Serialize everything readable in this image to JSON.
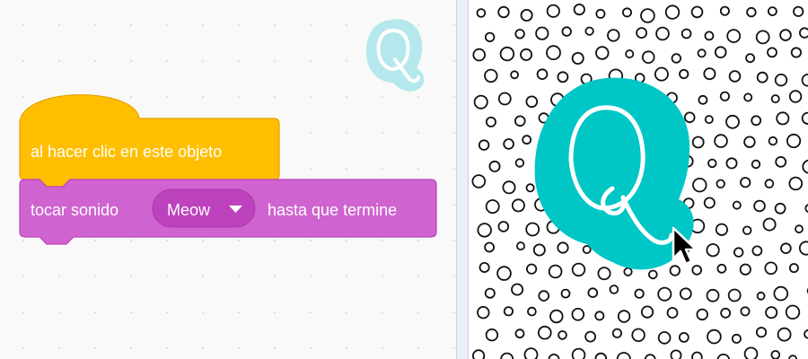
{
  "code_area": {
    "hat_block": {
      "label": "al hacer clic en este objeto",
      "color": "#FFBF00"
    },
    "sound_block": {
      "prefix": "tocar sonido",
      "sound_dropdown": {
        "selected": "Meow",
        "icon": "caret-down-icon"
      },
      "suffix": "hasta que termine",
      "color": "#CF63CF"
    },
    "sprite_thumbnail": {
      "letter": "Q",
      "color": "#B5E8EC"
    }
  },
  "stage": {
    "background": "polka-dots",
    "sprite": {
      "letter": "Q",
      "color": "#00C6C6"
    },
    "cursor": "arrow-pointer-icon"
  }
}
